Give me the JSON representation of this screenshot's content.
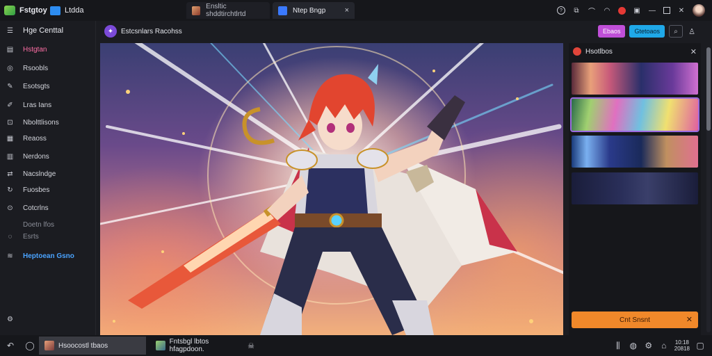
{
  "titlebar": {
    "brand": "Fstgtoy",
    "app2": "Ltdda",
    "tabs": [
      {
        "label": "Ensltic shddtirchtlrtd",
        "close": "×"
      },
      {
        "label": "Ntep Bngp",
        "close": "×"
      }
    ],
    "icons": [
      "help-icon",
      "screenshot-icon",
      "cast-icon",
      "wifi-icon",
      "record-icon",
      "video-icon",
      "minimize-icon",
      "maximize-icon",
      "close-icon"
    ]
  },
  "sidebar": {
    "items": [
      {
        "label": "Hge Centtal",
        "icon": "layout-icon"
      },
      {
        "label": "Hstgtan",
        "icon": "gallery-icon"
      },
      {
        "label": "Rsoobls",
        "icon": "rotate-icon"
      },
      {
        "label": "Esotsgts",
        "icon": "pen-icon"
      },
      {
        "label": "Lras Ians",
        "icon": "brush-icon"
      },
      {
        "label": "Nbolttlisons",
        "icon": "image-icon"
      },
      {
        "label": "Reaoss",
        "icon": "grid-icon"
      },
      {
        "label": "Nerdons",
        "icon": "list-icon"
      },
      {
        "label": "Nacslndge",
        "icon": "share-icon"
      },
      {
        "label": "Fuosbes",
        "icon": "refresh-icon"
      },
      {
        "label": "Cotcrlns",
        "icon": "compass-icon"
      },
      {
        "label": "Doetn lfos",
        "icon": ""
      },
      {
        "label": "Esrts",
        "icon": "bulb-icon"
      },
      {
        "label": "Heptoean Gsno",
        "icon": "stack-icon"
      }
    ],
    "footer_icon": "settings-icon"
  },
  "main": {
    "project_title": "Estcsnlars Racohss",
    "buttons": {
      "pink": "Ebaos",
      "blue": "Gtetoaos"
    }
  },
  "panel": {
    "title": "Hsotlbos",
    "generate_label": "Cnt Snsnt"
  },
  "bottombar": {
    "tabs": [
      {
        "label": "Hsoocostl tbaos"
      },
      {
        "label": "Fntsbgl lbtos hfagpdoon."
      }
    ],
    "clock": {
      "time": "10:18",
      "date": "20818"
    }
  },
  "colors": {
    "accent_pink": "#ff6fa6",
    "accent_blue": "#4aa3ff",
    "generate_orange": "#f0882a",
    "selection_purple": "#9b6be0"
  }
}
